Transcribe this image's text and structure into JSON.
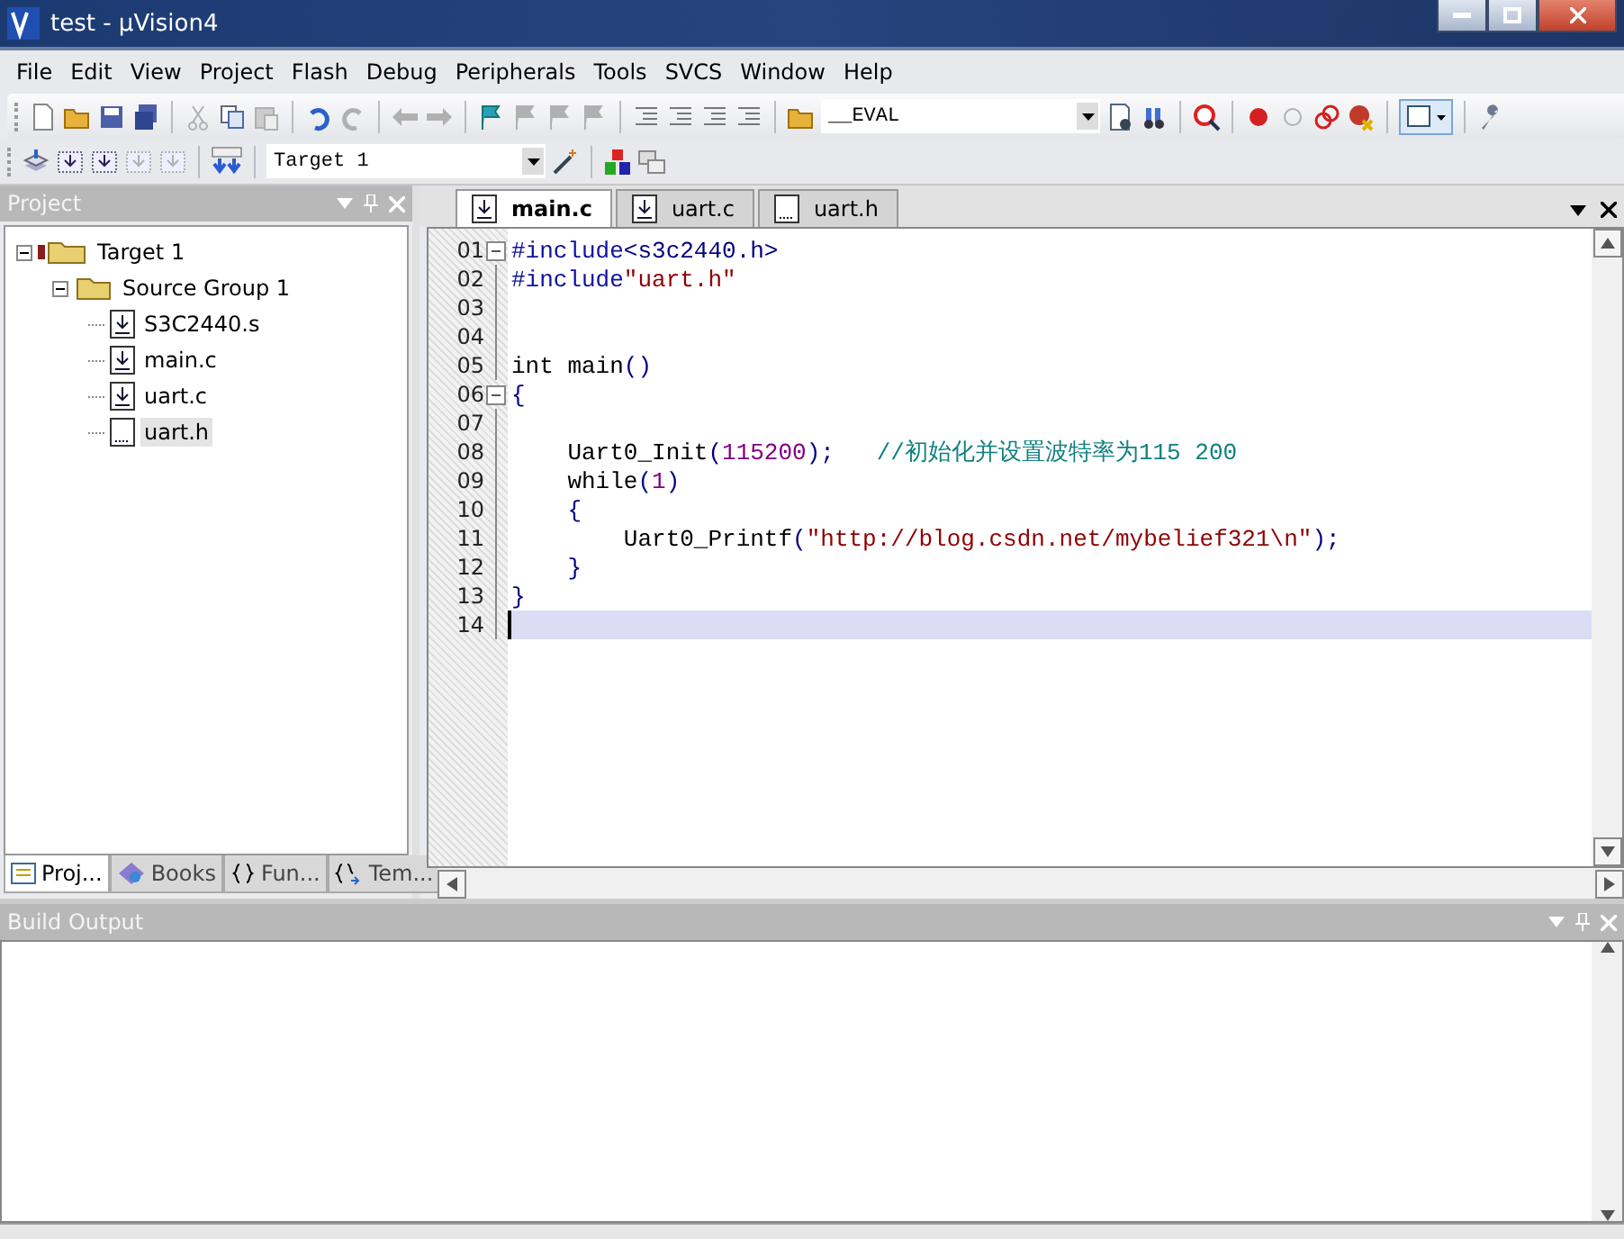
{
  "window": {
    "title": "test  - µVision4"
  },
  "menu": [
    "File",
    "Edit",
    "View",
    "Project",
    "Flash",
    "Debug",
    "Peripherals",
    "Tools",
    "SVCS",
    "Window",
    "Help"
  ],
  "toolbar": {
    "find_combo": "__EVAL",
    "target_combo": "Target 1"
  },
  "project_panel": {
    "title": "Project",
    "tree": [
      {
        "label": "Target 1",
        "kind": "target",
        "expanded": true,
        "selected": false,
        "children": [
          {
            "label": "Source Group 1",
            "kind": "group",
            "expanded": true,
            "selected": false,
            "children": [
              {
                "label": "S3C2440.s",
                "kind": "source",
                "selected": false
              },
              {
                "label": "main.c",
                "kind": "source",
                "selected": false
              },
              {
                "label": "uart.c",
                "kind": "source",
                "selected": false
              },
              {
                "label": "uart.h",
                "kind": "header",
                "selected": true
              }
            ]
          }
        ]
      }
    ],
    "tabs": [
      {
        "label": "Proj...",
        "kind": "project",
        "selected": true
      },
      {
        "label": "Books",
        "kind": "books",
        "selected": false
      },
      {
        "label": "Fun...",
        "kind": "functions",
        "selected": false
      },
      {
        "label": "Tem...",
        "kind": "templates",
        "selected": false
      }
    ]
  },
  "editor": {
    "tabs": [
      {
        "label": "main.c",
        "kind": "source",
        "selected": true
      },
      {
        "label": "uart.c",
        "kind": "source",
        "selected": false
      },
      {
        "label": "uart.h",
        "kind": "header",
        "selected": false
      }
    ],
    "lines": [
      {
        "number": "01",
        "fold": true,
        "current": false,
        "tokens": [
          {
            "kind": "directive",
            "text": "#include"
          },
          {
            "kind": "punct",
            "text": "<s3c2440.h>"
          }
        ]
      },
      {
        "number": "02",
        "fold": false,
        "current": false,
        "tokens": [
          {
            "kind": "directive",
            "text": "#include"
          },
          {
            "kind": "string",
            "text": "\"uart.h\""
          }
        ]
      },
      {
        "number": "03",
        "fold": false,
        "current": false
      },
      {
        "number": "04",
        "fold": false,
        "current": false
      },
      {
        "number": "05",
        "fold": false,
        "current": false,
        "tokens": [
          {
            "kind": "keyword",
            "text": "int"
          },
          {
            "kind": "plain",
            "text": " main"
          },
          {
            "kind": "punct",
            "text": "()"
          }
        ]
      },
      {
        "number": "06",
        "fold": true,
        "current": false,
        "tokens": [
          {
            "kind": "punct",
            "text": "{"
          }
        ]
      },
      {
        "number": "07",
        "fold": false,
        "current": false
      },
      {
        "number": "08",
        "fold": false,
        "current": false,
        "tokens": [
          {
            "kind": "plain",
            "text": "    Uart0_Init"
          },
          {
            "kind": "punct",
            "text": "("
          },
          {
            "kind": "number",
            "text": "115200"
          },
          {
            "kind": "punct",
            "text": ");"
          },
          {
            "kind": "comment",
            "text": "   //初始化并设置波特率为115 200"
          }
        ]
      },
      {
        "number": "09",
        "fold": false,
        "current": false,
        "tokens": [
          {
            "kind": "keyword",
            "text": "    while"
          },
          {
            "kind": "punct",
            "text": "("
          },
          {
            "kind": "number",
            "text": "1"
          },
          {
            "kind": "punct",
            "text": ")"
          }
        ]
      },
      {
        "number": "10",
        "fold": false,
        "current": false,
        "tokens": [
          {
            "kind": "punct",
            "text": "    {"
          }
        ]
      },
      {
        "number": "11",
        "fold": false,
        "current": false,
        "tokens": [
          {
            "kind": "plain",
            "text": "        Uart0_Printf"
          },
          {
            "kind": "punct",
            "text": "("
          },
          {
            "kind": "string",
            "text": "\"http://blog.csdn.net/mybelief321\\n\""
          },
          {
            "kind": "punct",
            "text": ");"
          }
        ]
      },
      {
        "number": "12",
        "fold": false,
        "current": false,
        "tokens": [
          {
            "kind": "punct",
            "text": "    }"
          }
        ]
      },
      {
        "number": "13",
        "fold": false,
        "current": false,
        "tokens": [
          {
            "kind": "punct",
            "text": "}"
          }
        ]
      },
      {
        "number": "14",
        "fold": false,
        "current": true
      }
    ]
  },
  "build_output": {
    "title": "Build Output"
  }
}
